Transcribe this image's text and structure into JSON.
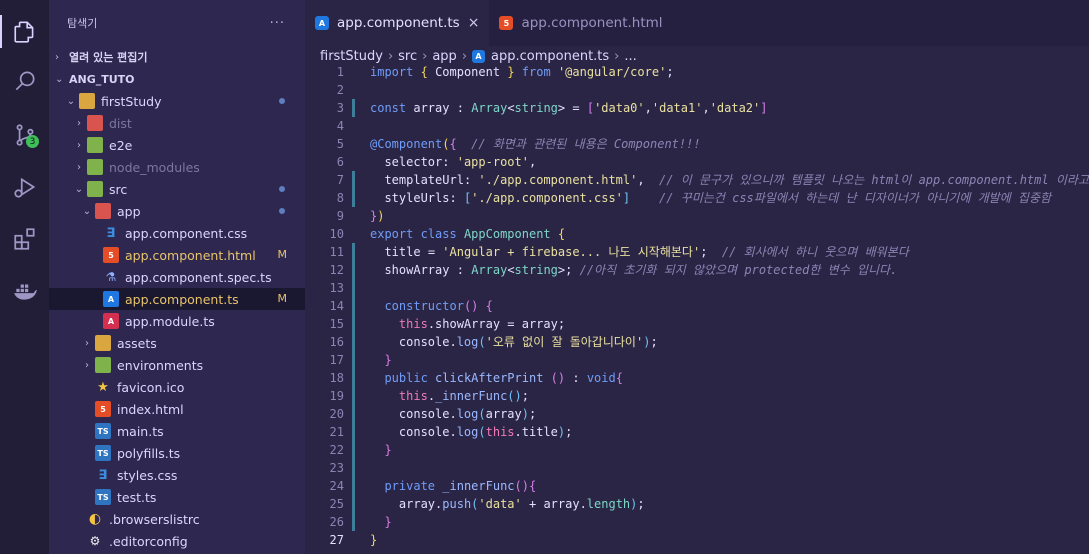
{
  "activity_bar": {
    "items": [
      {
        "name": "explorer-icon"
      },
      {
        "name": "search-icon"
      },
      {
        "name": "source-control-icon",
        "badge": "3"
      },
      {
        "name": "run-debug-icon"
      },
      {
        "name": "extensions-icon"
      },
      {
        "name": "docker-icon"
      }
    ]
  },
  "sidebar": {
    "title": "탐색기",
    "more": "···",
    "open_editors": "열려 있는 편집기",
    "project": "ANG_TUTO",
    "tree": [
      {
        "label": "firstStudy",
        "depth": 0,
        "chev": "⌄",
        "icon": "folder"
      },
      {
        "label": "dist",
        "depth": 1,
        "chev": "›",
        "icon": "folder-red",
        "dim": true
      },
      {
        "label": "e2e",
        "depth": 1,
        "chev": "›",
        "icon": "folder-green"
      },
      {
        "label": "node_modules",
        "depth": 1,
        "chev": "›",
        "icon": "folder-green",
        "dim": true
      },
      {
        "label": "src",
        "depth": 1,
        "chev": "⌄",
        "icon": "folder-green"
      },
      {
        "label": "app",
        "depth": 2,
        "chev": "⌄",
        "icon": "folder-red"
      },
      {
        "label": "app.component.css",
        "depth": 3,
        "icon": "css"
      },
      {
        "label": "app.component.html",
        "depth": 3,
        "icon": "html",
        "status": "M"
      },
      {
        "label": "app.component.spec.ts",
        "depth": 3,
        "icon": "spec"
      },
      {
        "label": "app.component.ts",
        "depth": 3,
        "icon": "angular",
        "status": "M"
      },
      {
        "label": "app.module.ts",
        "depth": 3,
        "icon": "angular-red"
      },
      {
        "label": "assets",
        "depth": 2,
        "chev": "›",
        "icon": "folder"
      },
      {
        "label": "environments",
        "depth": 2,
        "chev": "›",
        "icon": "folder-green"
      },
      {
        "label": "favicon.ico",
        "depth": 2,
        "icon": "star"
      },
      {
        "label": "index.html",
        "depth": 2,
        "icon": "html"
      },
      {
        "label": "main.ts",
        "depth": 2,
        "icon": "ts"
      },
      {
        "label": "polyfills.ts",
        "depth": 2,
        "icon": "ts"
      },
      {
        "label": "styles.css",
        "depth": 2,
        "icon": "css"
      },
      {
        "label": "test.ts",
        "depth": 2,
        "icon": "ts"
      },
      {
        "label": ".browserslistrc",
        "depth": 1,
        "icon": "rc"
      },
      {
        "label": ".editorconfig",
        "depth": 1,
        "icon": "editorconfig"
      }
    ]
  },
  "tabs": [
    {
      "label": "app.component.ts",
      "active": true,
      "icon": "angular",
      "close": "×"
    },
    {
      "label": "app.component.html",
      "active": false,
      "icon": "html"
    }
  ],
  "breadcrumb": {
    "parts": [
      "firstStudy",
      "src",
      "app",
      "app.component.ts",
      "..."
    ]
  },
  "code": {
    "line_numbers": [
      "1",
      "2",
      "3",
      "4",
      "5",
      "6",
      "7",
      "8",
      "9",
      "10",
      "11",
      "12",
      "13",
      "14",
      "15",
      "16",
      "17",
      "18",
      "19",
      "20",
      "21",
      "22",
      "23",
      "24",
      "25",
      "26",
      "27"
    ],
    "comments": {
      "l5": "// 화면과 관련된 내용은 Component!!!",
      "l7": "// 이 문구가 있으니까 템플릿 나오는 html이 app.component.html 이라고",
      "l8": "// 꾸미는건 css파일에서 하는데 난 디자이너가 아니기에 개발에 집중함",
      "l11": "// 회사에서 하니 웃으며 배워본다",
      "l12": "//아직 초기화 되지 않았으며 protected한 변수 입니다."
    },
    "strings": {
      "l1": "'@angular/core'",
      "l3a": "'data0'",
      "l3b": "'data1'",
      "l3c": "'data2'",
      "l6": "'app-root'",
      "l7": "'./app.component.html'",
      "l8": "'./app.component.css'",
      "l11": "'Angular + firebase... 나도 시작해본다'",
      "l16": "'오류 없이 잘 돌아갑니다이'",
      "l25": "'data'"
    }
  }
}
